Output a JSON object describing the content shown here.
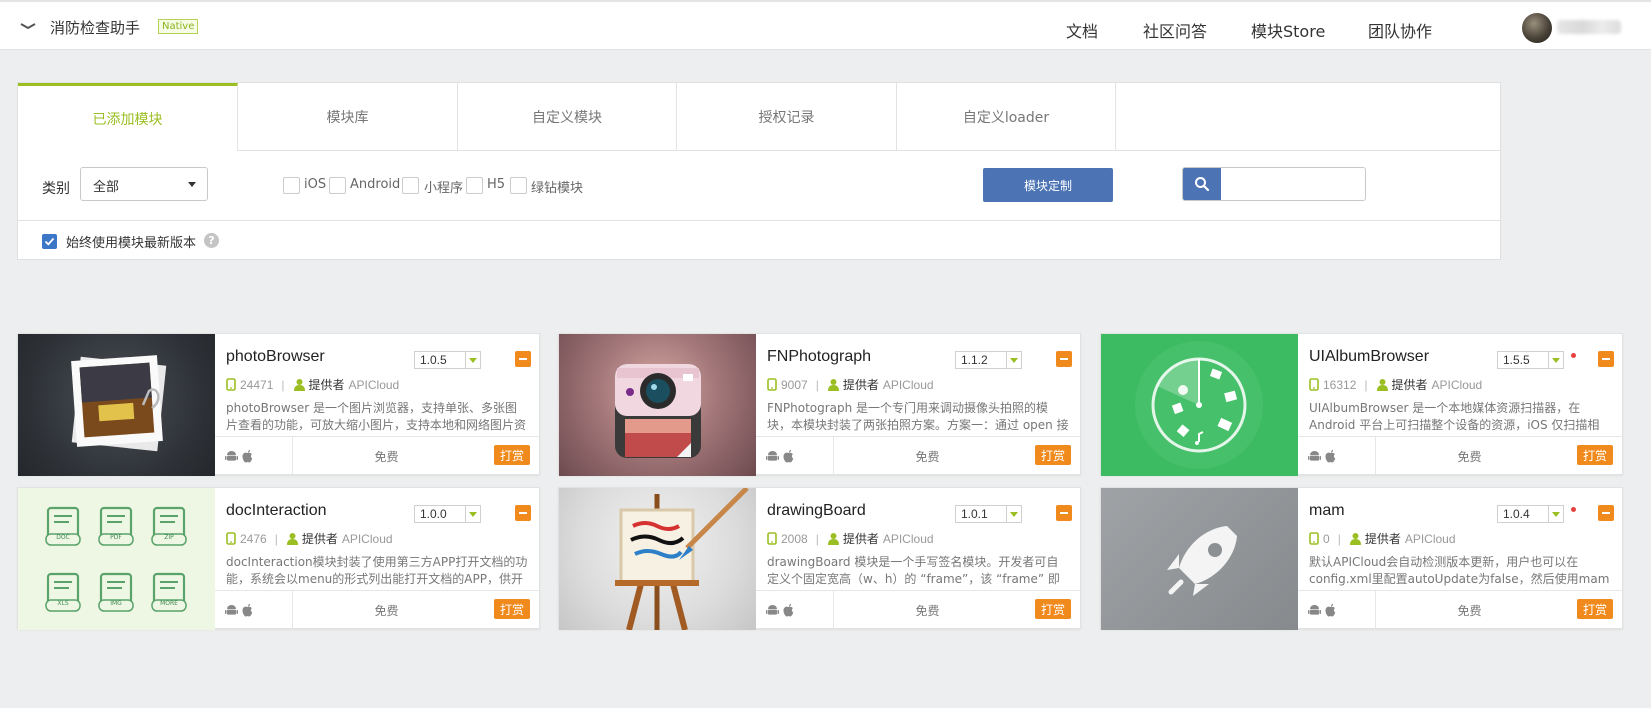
{
  "header": {
    "app_title": "消防检查助手",
    "badge": "Native",
    "nav": [
      "文档",
      "社区问答",
      "模块Store",
      "团队协作"
    ]
  },
  "tabs": [
    "已添加模块",
    "模块库",
    "自定义模块",
    "授权记录",
    "自定义loader"
  ],
  "filters": {
    "category_label": "类别",
    "category_value": "全部",
    "platforms": [
      "iOS",
      "Android",
      "小程序",
      "H5",
      "绿钻模块"
    ],
    "custom_button": "模块定制",
    "search_placeholder": "",
    "latest_label": "始终使用模块最新版本",
    "help": "?"
  },
  "modules": [
    {
      "name": "photoBrowser",
      "version": "1.0.5",
      "downloads": "24471",
      "provider_label": "提供者",
      "provider": "APICloud",
      "desc": "photoBrowser 是一个图片浏览器，支持单张、多张图片查看的功能，可放大缩小图片，支持本地和网络图片资源",
      "price": "免费",
      "tip": "打赏",
      "update": false,
      "image": "photo-browser"
    },
    {
      "name": "FNPhotograph",
      "version": "1.1.2",
      "downloads": "9007",
      "provider_label": "提供者",
      "provider": "APICloud",
      "desc": "FNPhotograph 是一个专门用来调动摄像头拍照的模块，本模块封装了两张拍照方案。方案一：通过 open 接口打开",
      "price": "免费",
      "tip": "打赏",
      "update": false,
      "image": "camera"
    },
    {
      "name": "UIAlbumBrowser",
      "version": "1.5.5",
      "downloads": "16312",
      "provider_label": "提供者",
      "provider": "APICloud",
      "desc": "UIAlbumBrowser 是一个本地媒体资源扫描器，在 Android 平台上可扫描整个设备的资源，iOS 仅扫描相册内的",
      "price": "免费",
      "tip": "打赏",
      "update": true,
      "image": "album-radar"
    },
    {
      "name": "docInteraction",
      "version": "1.0.0",
      "downloads": "2476",
      "provider_label": "提供者",
      "provider": "APICloud",
      "desc": "docInteraction模块封装了使用第三方APP打开文档的功能，系统会以menu的形式列出能打开文档的APP，供开",
      "price": "免费",
      "tip": "打赏",
      "update": false,
      "image": "doc-icons",
      "doc_icons": [
        "DOC",
        "PDF",
        "ZIP",
        "XLS",
        "IMG",
        "MORE"
      ]
    },
    {
      "name": "drawingBoard",
      "version": "1.0.1",
      "downloads": "2008",
      "provider_label": "提供者",
      "provider": "APICloud",
      "desc": "drawingBoard 模块是一个手写签名模块。开发者可自定义个固定宽高（w、h）的 “frame”，该 “frame” 即",
      "price": "免费",
      "tip": "打赏",
      "update": false,
      "image": "easel"
    },
    {
      "name": "mam",
      "version": "1.0.4",
      "downloads": "0",
      "provider_label": "提供者",
      "provider": "APICloud",
      "desc": "默认APICloud会自动检测版本更新，用户也可以在config.xml里配置autoUpdate为false，然后使用mam模块来",
      "price": "免费",
      "tip": "打赏",
      "update": true,
      "image": "rocket"
    }
  ],
  "colors": {
    "accent": "#9bbf23",
    "primary": "#4c74b5",
    "orange": "#f08a1d"
  }
}
